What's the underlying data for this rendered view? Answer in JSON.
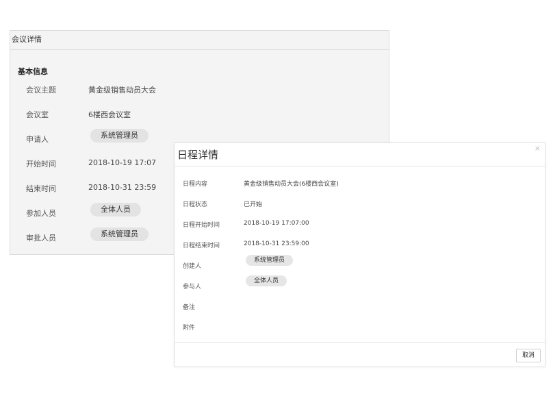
{
  "meeting": {
    "header": "会议详情",
    "section_title": "基本信息",
    "topic_label": "会议主题",
    "topic_value": "黄金级销售动员大会",
    "room_label": "会议室",
    "room_value": "6楼西会议室",
    "applicant_label": "申请人",
    "applicant_tag": "系统管理员",
    "start_label": "开始时间",
    "start_value": "2018-10-19 17:07",
    "end_label": "结束时间",
    "end_value": "2018-10-31 23:59",
    "participants_label": "参加人员",
    "participants_tag": "全体人员",
    "approvers_label": "审批人员",
    "approvers_tag": "系统管理员"
  },
  "schedule": {
    "title": "日程详情",
    "close_icon": "×",
    "content_label": "日程内容",
    "content_value": "黄金级销售动员大会(6楼西会议室)",
    "status_label": "日程状态",
    "status_value": "已开始",
    "start_label": "日程开始时间",
    "start_value": "2018-10-19 17:07:00",
    "end_label": "日程结束时间",
    "end_value": "2018-10-31 23:59:00",
    "creator_label": "创建人",
    "creator_tag": "系统管理员",
    "participants_label": "参与人",
    "participants_tag": "全体人员",
    "remarks_label": "备注",
    "attachments_label": "附件",
    "cancel_label": "取消"
  }
}
